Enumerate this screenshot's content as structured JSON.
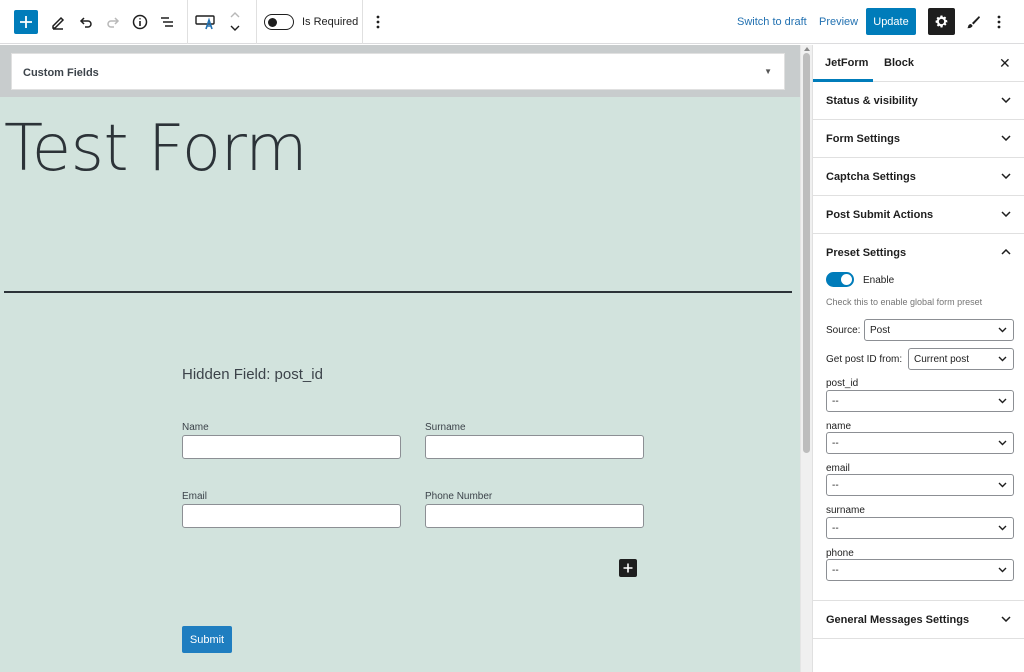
{
  "toolbar": {
    "required_label": "Is Required",
    "switch_to_draft": "Switch to draft",
    "preview": "Preview",
    "update": "Update"
  },
  "metabox": {
    "title": "Custom Fields",
    "arrow": "▼"
  },
  "form": {
    "title": "Test Form",
    "hidden_field": "Hidden Field: post_id",
    "fields": [
      {
        "label": "Name"
      },
      {
        "label": "Surname"
      },
      {
        "label": "Email"
      },
      {
        "label": "Phone Number"
      }
    ],
    "submit": "Submit"
  },
  "sidebar": {
    "tabs": [
      "JetForm",
      "Block"
    ],
    "close": "✕",
    "panels": [
      "Status & visibility",
      "Form Settings",
      "Captcha Settings",
      "Post Submit Actions",
      "Preset Settings",
      "General Messages Settings"
    ],
    "preset": {
      "toggle_label": "Enable",
      "toggle_on": true,
      "help": "Check this to enable global form preset",
      "source_label": "Source:",
      "source_value": "Post",
      "post_id_from_label": "Get post ID from:",
      "post_id_from_value": "Current post",
      "mappings": [
        {
          "field": "post_id",
          "value": "--"
        },
        {
          "field": "name",
          "value": "--"
        },
        {
          "field": "email",
          "value": "--"
        },
        {
          "field": "surname",
          "value": "--"
        },
        {
          "field": "phone",
          "value": "--"
        }
      ]
    }
  },
  "colors": {
    "accent": "#007cba",
    "canvas_bg": "#d2e3dd",
    "dark": "#1e1e1e"
  }
}
